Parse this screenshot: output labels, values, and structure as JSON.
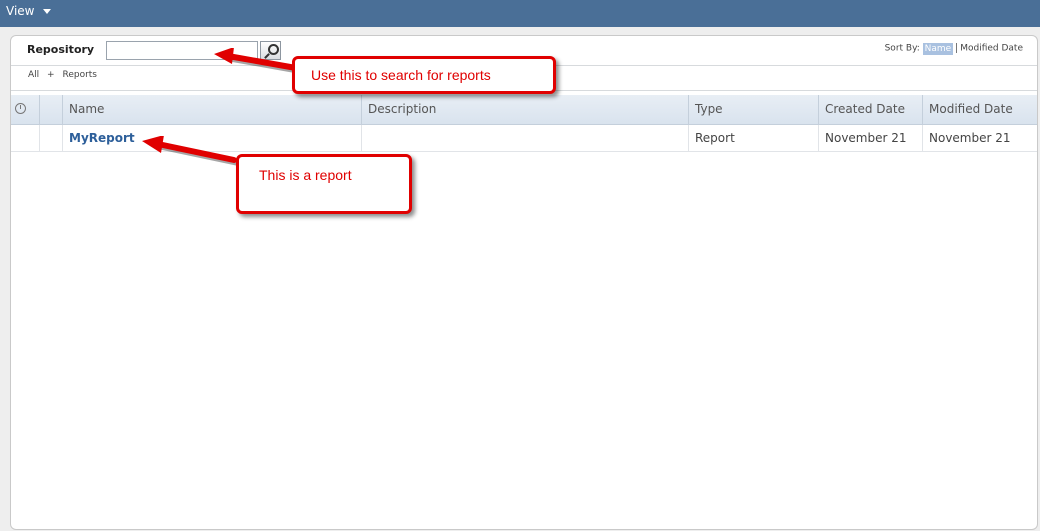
{
  "toolbar": {
    "view_label": "View"
  },
  "repository": {
    "label": "Repository",
    "search_value": "",
    "sort_by_label": "Sort By:",
    "sort_options": [
      "Name",
      "Modified Date"
    ],
    "breadcrumb": [
      "All",
      "+",
      "Reports"
    ]
  },
  "table": {
    "columns": [
      "Name",
      "Description",
      "Type",
      "Created Date",
      "Modified Date"
    ],
    "rows": [
      {
        "name": "MyReport",
        "description": "",
        "type": "Report",
        "created": "November 21",
        "modified": "November 21"
      }
    ]
  },
  "annotations": {
    "search_callout": "Use this to search for reports",
    "report_callout": "This is a report"
  },
  "colors": {
    "topbar": "#4a6f97",
    "link": "#2d5f9a",
    "callout_red": "#e00000"
  }
}
